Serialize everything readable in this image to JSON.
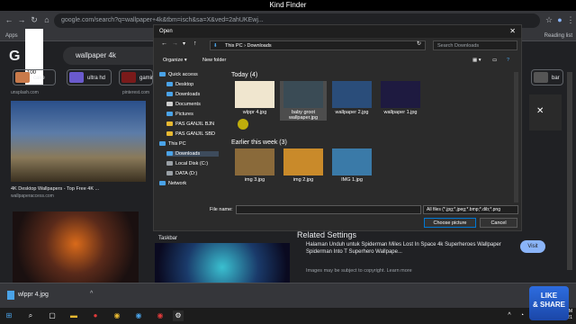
{
  "window": {
    "title": "Kind Finder"
  },
  "browser": {
    "url": "google.com/search?q=wallpaper+4k&tbm=isch&sa=X&ved=2ahUKEwj...",
    "bookmarks_label": "Apps",
    "reading_list": "Reading list",
    "zoom_value": "100"
  },
  "google": {
    "logo": "G",
    "search_value": "wallpaper 4k",
    "chips": [
      "cake",
      "ultra hd",
      "gaming",
      "bar"
    ],
    "results": [
      {
        "source": "unsplash.com",
        "caption": ""
      },
      {
        "source": "pinterest.com",
        "caption": ""
      },
      {
        "source": "wallpaperaccess.com",
        "caption": "4K Desktop Wallpapers - Top Free 4K ..."
      }
    ],
    "related_title": "Related Settings",
    "ad_text": "Halaman Unduh untuk Spiderman Miles Lost In Space 4k Superheroes Wallpaper Spiderman Into T Superhero Wallpape...",
    "copyright_note": "Images may be subject to copyright. Learn more",
    "visit_label": "Visit",
    "taskbar_label": "Taskbar"
  },
  "dialog": {
    "title": "Open",
    "close": "✕",
    "breadcrumb": [
      "This PC",
      "Downloads"
    ],
    "search_placeholder": "Search Downloads",
    "organize": "Organize ▾",
    "new_folder": "New folder",
    "sidebar": [
      {
        "label": "Quick access",
        "icon": "star-icon",
        "color": "#4aa3e8",
        "indent": 0
      },
      {
        "label": "Desktop",
        "icon": "desktop-icon",
        "color": "#4aa3e8",
        "indent": 1
      },
      {
        "label": "Downloads",
        "icon": "download-icon",
        "color": "#4aa3e8",
        "indent": 1
      },
      {
        "label": "Documents",
        "icon": "document-icon",
        "color": "#d0d0d0",
        "indent": 1
      },
      {
        "label": "Pictures",
        "icon": "picture-icon",
        "color": "#4aa3e8",
        "indent": 1
      },
      {
        "label": "PAS GANJIL BJN",
        "icon": "folder-icon",
        "color": "#e8b931",
        "indent": 1
      },
      {
        "label": "PAS GANJIL SBD",
        "icon": "folder-icon",
        "color": "#e8b931",
        "indent": 1
      },
      {
        "label": "This PC",
        "icon": "pc-icon",
        "color": "#4aa3e8",
        "indent": 0
      },
      {
        "label": "Downloads",
        "icon": "download-icon",
        "color": "#4aa3e8",
        "indent": 1,
        "selected": true
      },
      {
        "label": "Local Disk (C:)",
        "icon": "disk-icon",
        "color": "#9aa0a6",
        "indent": 1
      },
      {
        "label": "DATA (D:)",
        "icon": "disk-icon",
        "color": "#9aa0a6",
        "indent": 1
      },
      {
        "label": "Network",
        "icon": "network-icon",
        "color": "#4aa3e8",
        "indent": 0
      }
    ],
    "groups": [
      {
        "label": "Today (4)"
      },
      {
        "label": "Earlier this week (3)"
      }
    ],
    "files_today": [
      {
        "name": "wlppr 4.jpg",
        "color": "#f0e6cf"
      },
      {
        "name": "baby groot wallpaper.jpg",
        "color": "#3a4b55",
        "selected": true
      },
      {
        "name": "wallpaper 2.jpg",
        "color": "#2a4d7a"
      },
      {
        "name": "wallpaper 1.jpg",
        "color": "#1e1a40"
      }
    ],
    "files_week": [
      {
        "name": "img 3.jpg",
        "color": "#8a6a3a"
      },
      {
        "name": "img 2.jpg",
        "color": "#c98a2a"
      },
      {
        "name": "IMG 1.jpg",
        "color": "#3a7aa8"
      }
    ],
    "file_name_label": "File name:",
    "file_name_value": "",
    "filter": "All files (*.jpg;*.jpeg;*.bmp;*.dib;*.png",
    "choose_label": "Choose picture",
    "cancel_label": "Cancel"
  },
  "downloads_bar": {
    "filename": "wlppr 4.jpg",
    "arrow": "^"
  },
  "taskbar": {
    "time": "4:28 PM",
    "date": "12/1/2021"
  },
  "watermark": {
    "line1": "LIKE",
    "line2": "& SHARE"
  }
}
